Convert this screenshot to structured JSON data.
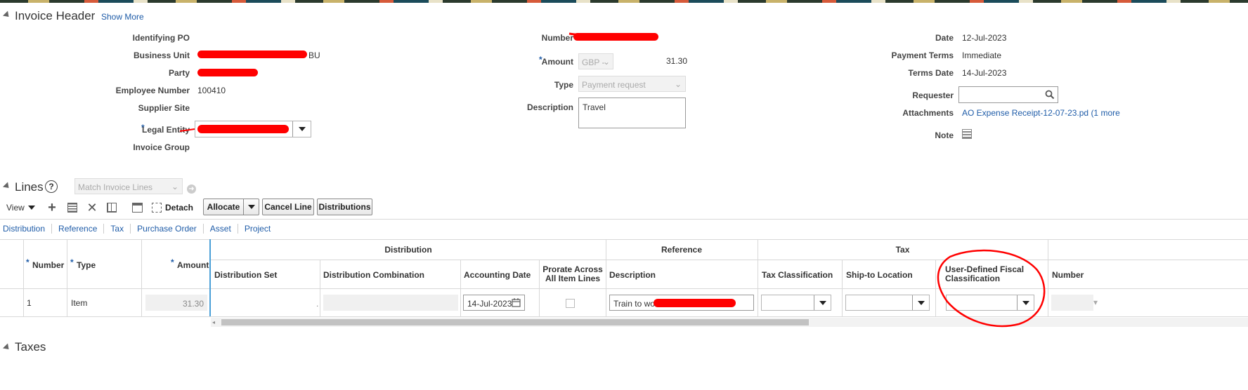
{
  "invoice_header": {
    "title": "Invoice Header",
    "show_more": "Show More",
    "col1": {
      "identifying_po_label": "Identifying PO",
      "business_unit_label": "Business Unit",
      "business_unit_suffix": "BU",
      "party_label": "Party",
      "employee_number_label": "Employee Number",
      "employee_number_value": "100410",
      "supplier_site_label": "Supplier Site",
      "legal_entity_label": "Legal Entity",
      "invoice_group_label": "Invoice Group"
    },
    "col2": {
      "number_label": "Number",
      "amount_label": "Amount",
      "currency_value": "GBP -",
      "amount_value": "31.30",
      "type_label": "Type",
      "type_value": "Payment request",
      "description_label": "Description",
      "description_value": "Travel"
    },
    "col3": {
      "date_label": "Date",
      "date_value": "12-Jul-2023",
      "payment_terms_label": "Payment Terms",
      "payment_terms_value": "Immediate",
      "terms_date_label": "Terms Date",
      "terms_date_value": "14-Jul-2023",
      "requester_label": "Requester",
      "attachments_label": "Attachments",
      "attachments_value": "AO Expense Receipt-12-07-23.pd (1 more",
      "note_label": "Note"
    },
    "required_marker": "*"
  },
  "lines": {
    "title": "Lines",
    "help": "?",
    "match_placeholder": "Match Invoice Lines",
    "toolbar": {
      "view_label": "View",
      "detach_label": "Detach",
      "allocate_label": "Allocate",
      "cancel_line_label": "Cancel Line",
      "distributions_label": "Distributions"
    },
    "tabs": [
      "Distribution",
      "Reference",
      "Tax",
      "Purchase Order",
      "Asset",
      "Project"
    ],
    "group_headers": {
      "distribution": "Distribution",
      "reference": "Reference",
      "tax": "Tax"
    },
    "columns": {
      "number": "Number",
      "type": "Type",
      "amount": "Amount",
      "distribution_set": "Distribution Set",
      "distribution_combination": "Distribution Combination",
      "accounting_date": "Accounting Date",
      "prorate": "Prorate Across All Item Lines",
      "description": "Description",
      "tax_classification": "Tax Classification",
      "ship_to_location": "Ship-to Location",
      "user_defined_fiscal": "User-Defined Fiscal Classification",
      "number2": "Number"
    },
    "row": {
      "number": "1",
      "type": "Item",
      "amount": "31.30",
      "distribution_combination_dot": ".",
      "accounting_date": "14-Jul-2023",
      "description": "Train to work"
    }
  },
  "taxes": {
    "title": "Taxes"
  },
  "colors": {
    "annotation_red": "#ff0000",
    "link_blue": "#1f5ca8"
  }
}
